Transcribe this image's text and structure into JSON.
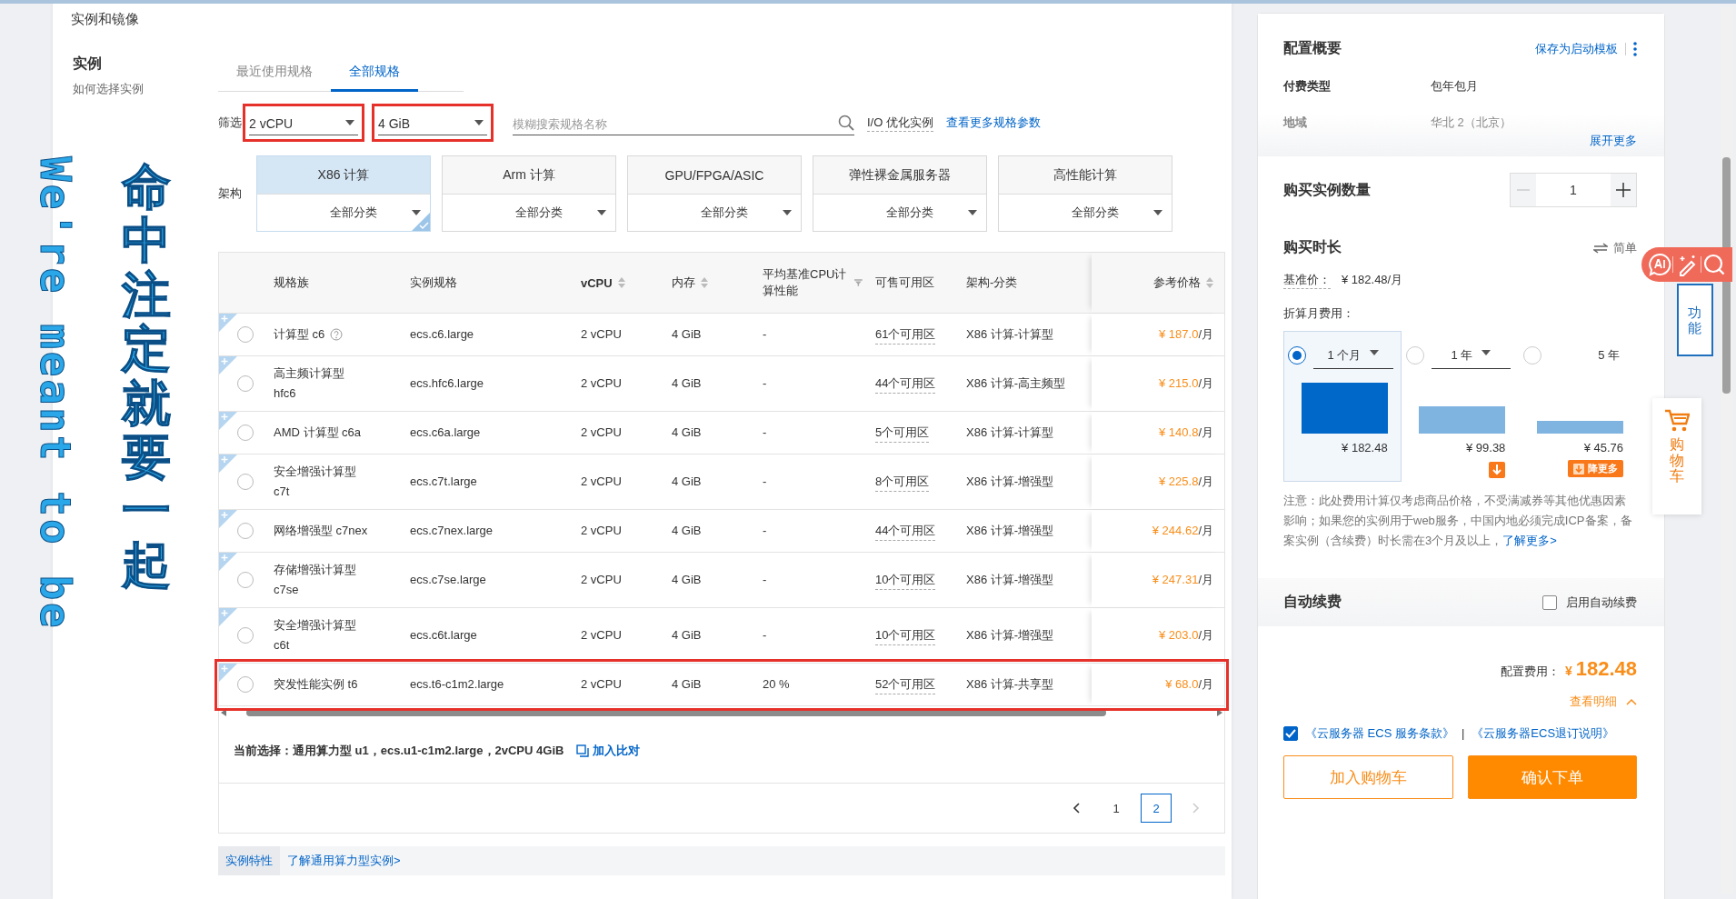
{
  "section_title": "实例和镜像",
  "instance": {
    "title": "实例",
    "help_link": "如何选择实例"
  },
  "tabs": [
    {
      "label": "最近使用规格",
      "selected": false
    },
    {
      "label": "全部规格",
      "selected": true
    }
  ],
  "filters": {
    "label": "筛选",
    "selects": [
      {
        "value": "2 vCPU",
        "highlighted": true
      },
      {
        "value": "4 GiB",
        "highlighted": true
      }
    ],
    "search": {
      "placeholder": "模糊搜索规格名称"
    },
    "io_optimized": "I/O 优化实例",
    "more_params_link": "查看更多规格参数"
  },
  "architecture": {
    "label": "架构",
    "options": [
      {
        "name": "X86 计算",
        "category": "全部分类",
        "selected": true
      },
      {
        "name": "Arm 计算",
        "category": "全部分类",
        "selected": false
      },
      {
        "name": "GPU/FPGA/ASIC",
        "category": "全部分类",
        "selected": false
      },
      {
        "name": "弹性裸金属服务器",
        "category": "全部分类",
        "selected": false
      },
      {
        "name": "高性能计算",
        "category": "全部分类",
        "selected": false
      }
    ]
  },
  "table": {
    "columns": [
      {
        "label": "规格族",
        "kind": "plain"
      },
      {
        "label": "实例规格",
        "kind": "plain"
      },
      {
        "label": "vCPU",
        "kind": "sort"
      },
      {
        "label": "内存",
        "kind": "sort"
      },
      {
        "label": "平均基准CPU计算性能",
        "kind": "filter"
      },
      {
        "label": "可售可用区",
        "kind": "plain"
      },
      {
        "label": "架构-分类",
        "kind": "plain"
      },
      {
        "label": "参考价格",
        "kind": "sort"
      }
    ],
    "rows": [
      {
        "family": "计算型 c6",
        "help": true,
        "spec": "ecs.c6.large",
        "vcpu": "2 vCPU",
        "memory": "4 GiB",
        "cpu_baseline": "-",
        "zones": "61个可用区",
        "arch": "X86 计算-计算型",
        "price": "¥ 187.0",
        "unit": "/月",
        "selected": false,
        "highlighted": false
      },
      {
        "family": "高主频计算型\nhfc6",
        "help": false,
        "spec": "ecs.hfc6.large",
        "vcpu": "2 vCPU",
        "memory": "4 GiB",
        "cpu_baseline": "-",
        "zones": "44个可用区",
        "arch": "X86 计算-高主频型",
        "price": "¥ 215.0",
        "unit": "/月",
        "selected": false,
        "highlighted": false
      },
      {
        "family": "AMD 计算型 c6a",
        "help": false,
        "spec": "ecs.c6a.large",
        "vcpu": "2 vCPU",
        "memory": "4 GiB",
        "cpu_baseline": "-",
        "zones": "5个可用区",
        "arch": "X86 计算-计算型",
        "price": "¥ 140.8",
        "unit": "/月",
        "selected": false,
        "highlighted": false
      },
      {
        "family": "安全增强计算型\nc7t",
        "help": false,
        "spec": "ecs.c7t.large",
        "vcpu": "2 vCPU",
        "memory": "4 GiB",
        "cpu_baseline": "-",
        "zones": "8个可用区",
        "arch": "X86 计算-增强型",
        "price": "¥ 225.8",
        "unit": "/月",
        "selected": false,
        "highlighted": false
      },
      {
        "family": "网络增强型 c7nex",
        "help": false,
        "spec": "ecs.c7nex.large",
        "vcpu": "2 vCPU",
        "memory": "4 GiB",
        "cpu_baseline": "-",
        "zones": "44个可用区",
        "arch": "X86 计算-增强型",
        "price": "¥ 244.62",
        "unit": "/月",
        "selected": false,
        "highlighted": false
      },
      {
        "family": "存储增强计算型\nc7se",
        "help": false,
        "spec": "ecs.c7se.large",
        "vcpu": "2 vCPU",
        "memory": "4 GiB",
        "cpu_baseline": "-",
        "zones": "10个可用区",
        "arch": "X86 计算-增强型",
        "price": "¥ 247.31",
        "unit": "/月",
        "selected": false,
        "highlighted": false
      },
      {
        "family": "安全增强计算型\nc6t",
        "help": false,
        "spec": "ecs.c6t.large",
        "vcpu": "2 vCPU",
        "memory": "4 GiB",
        "cpu_baseline": "-",
        "zones": "10个可用区",
        "arch": "X86 计算-增强型",
        "price": "¥ 203.0",
        "unit": "/月",
        "selected": false,
        "highlighted": false
      },
      {
        "family": "突发性能实例 t6",
        "help": false,
        "spec": "ecs.t6-c1m2.large",
        "vcpu": "2 vCPU",
        "memory": "4 GiB",
        "cpu_baseline": "20 %",
        "zones": "52个可用区",
        "arch": "X86 计算-共享型",
        "price": "¥ 68.0",
        "unit": "/月",
        "selected": false,
        "highlighted": true
      }
    ]
  },
  "current_selection": {
    "text": "当前选择：通用算力型 u1，ecs.u1-c1m2.large，2vCPU 4GiB",
    "compare_link": "加入比对"
  },
  "pagination": {
    "prev_disabled": false,
    "next_disabled": true,
    "pages": [
      {
        "label": "1",
        "selected": false
      },
      {
        "label": "2",
        "selected": true
      }
    ]
  },
  "footer_tabs": [
    {
      "label": "实例特性",
      "selected": true
    },
    {
      "label": "了解通用算力型实例>",
      "selected": false
    }
  ],
  "summary": {
    "title": "配置概要",
    "save_link": "保存为启动模板",
    "rows": [
      {
        "label": "付费类型",
        "value": "包年包月"
      },
      {
        "label": "地域",
        "value": "华北 2（北京）"
      }
    ],
    "expand_link": "展开更多"
  },
  "quantity": {
    "title": "购买实例数量",
    "value": "1",
    "minus_disabled": true
  },
  "duration": {
    "title": "购买时长",
    "mode_link": "简单",
    "base_price_label": "基准价：",
    "base_price": "¥ 182.48/月",
    "monthly_label": "折算月费用：",
    "options": [
      {
        "label": "1 个月",
        "kind": "select",
        "selected": true,
        "price": "¥ 182.48",
        "badge": false
      },
      {
        "label": "1 年",
        "kind": "select",
        "selected": false,
        "price": "¥ 99.38",
        "badge": true
      },
      {
        "label": "5 年",
        "kind": "plain",
        "selected": false,
        "price": "¥ 45.76",
        "badge": true,
        "badge_text": "降更多"
      }
    ],
    "note": "注意：此处费用计算仅考虑商品价格，不受满减券等其他优惠因素影响；如果您的实例用于web服务，中国内地必须完成ICP备案，备案实例（含续费）时长需在3个月及以上，",
    "note_link": "了解更多>"
  },
  "auto_renew": {
    "title": "自动续费",
    "label": "启用自动续费",
    "checked": false
  },
  "total": {
    "label": "配置费用：",
    "currency": "¥",
    "amount": "182.48",
    "details_link": "查看明细"
  },
  "agreement": {
    "checked": true,
    "links": [
      "《云服务器 ECS 服务条款》",
      "《云服务器ECS退订说明》"
    ],
    "separator": "|"
  },
  "buttons": [
    {
      "label": "加入购物车",
      "kind": "secondary"
    },
    {
      "label": "确认下单",
      "kind": "primary"
    }
  ],
  "floating": {
    "feature_tab": "功能",
    "cart_label": "购物车"
  },
  "overlay_texts": [
    {
      "text": "We're meant to be",
      "kind": "latin"
    },
    {
      "text": "命中注定就要一起",
      "kind": "cjk"
    }
  ]
}
